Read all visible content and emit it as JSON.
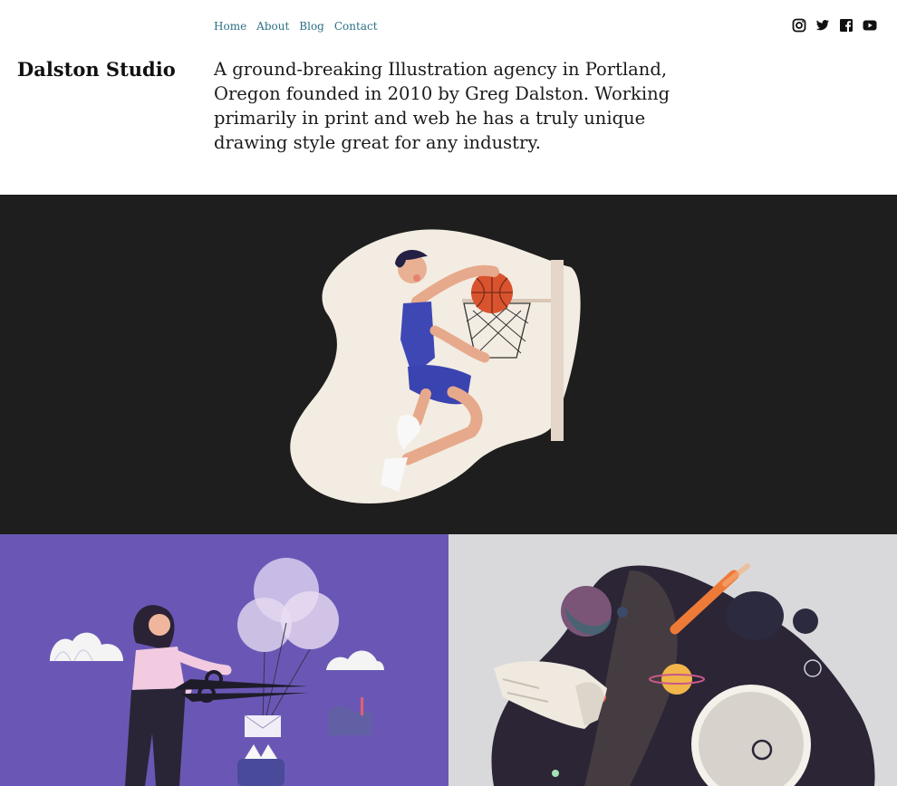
{
  "nav": {
    "items": [
      {
        "label": "Home"
      },
      {
        "label": "About"
      },
      {
        "label": "Blog"
      },
      {
        "label": "Contact"
      }
    ]
  },
  "social": {
    "icons": [
      "instagram-icon",
      "twitter-icon",
      "facebook-icon",
      "youtube-icon"
    ]
  },
  "brand": {
    "name": "Dalston Studio"
  },
  "intro": {
    "text": "A ground-breaking Illustration agency in Portland, Oregon founded in 2010 by Greg Dalston. Working primarily in print and web he has a truly unique drawing style great for any industry."
  },
  "colors": {
    "link": "#2d6f86",
    "dark_panel": "#1e1e1e",
    "purple_panel": "#6a57b5",
    "grey_panel": "#d9d9db"
  }
}
